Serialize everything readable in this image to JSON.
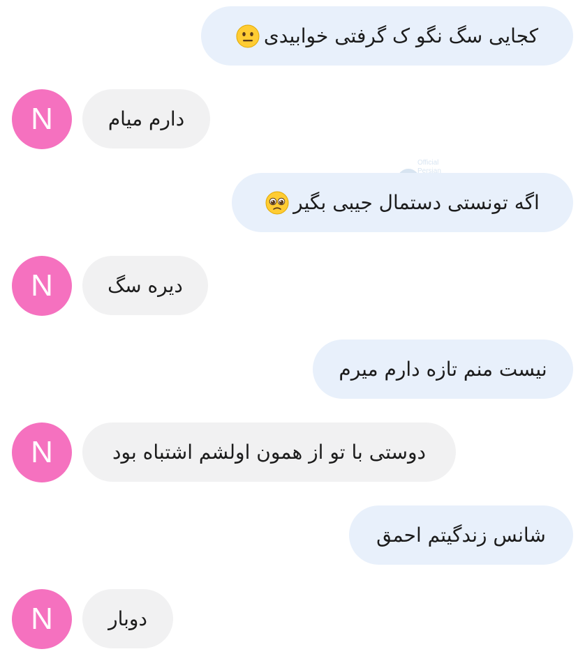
{
  "conversation": {
    "contact_initial": "N",
    "messages": [
      {
        "direction": "outgoing",
        "text": "کجایی سگ نگو ک گرفتی خوابیدی",
        "emoji": "neutral-face"
      },
      {
        "direction": "incoming",
        "text": "دارم میام"
      },
      {
        "direction": "outgoing",
        "text": "اگه تونستی دستمال جیبی بگیر",
        "emoji": "pleading-face"
      },
      {
        "direction": "incoming",
        "text": "دیره سگ"
      },
      {
        "direction": "outgoing",
        "text": "نیست منم تازه دارم میرم"
      },
      {
        "direction": "incoming",
        "text": "دوستی با تو از همون اولشم اشتباه بود"
      },
      {
        "direction": "outgoing",
        "text": "شانس زندگیتم احمق"
      },
      {
        "direction": "incoming",
        "text": "دوبار"
      }
    ]
  },
  "colors": {
    "outgoing_bubble": "#e8f0fb",
    "incoming_bubble": "#f1f1f2",
    "avatar": "#f571bf"
  }
}
